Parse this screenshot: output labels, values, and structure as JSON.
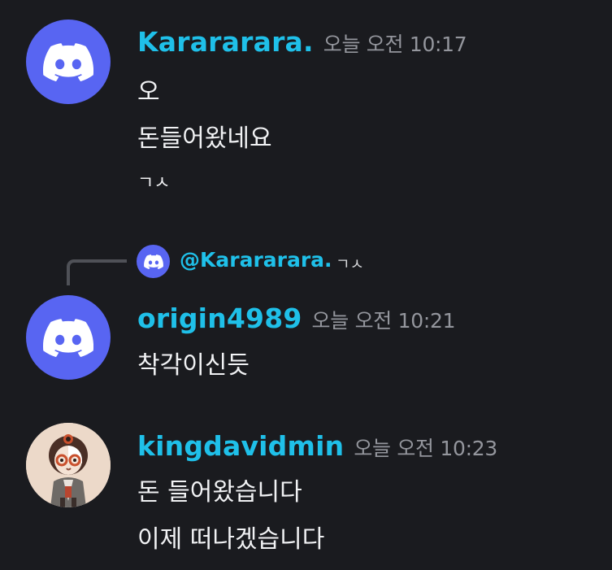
{
  "messages": [
    {
      "author": "Karararara.",
      "timestamp": "오늘 오전 10:17",
      "lines": [
        "오",
        "돈들어왔네요",
        "ㄱㅅ"
      ],
      "avatar_icon": "discord-logo-icon"
    },
    {
      "reply": {
        "mention": "@Karararara.",
        "preview": "ㄱㅅ"
      },
      "author": "origin4989",
      "timestamp": "오늘 오전 10:21",
      "lines": [
        "착각이신듯"
      ],
      "avatar_icon": "discord-logo-icon"
    },
    {
      "author": "kingdavidmin",
      "timestamp": "오늘 오전 10:23",
      "lines": [
        "돈 들어왔습니다",
        "이제 떠나겠습니다"
      ],
      "avatar_icon": "character-avatar-icon"
    }
  ],
  "colors": {
    "background": "#1a1b1f",
    "username": "#1fc0e9",
    "timestamp": "#94969d",
    "message_text": "#f1f2f4",
    "blurple": "#5865f2"
  }
}
